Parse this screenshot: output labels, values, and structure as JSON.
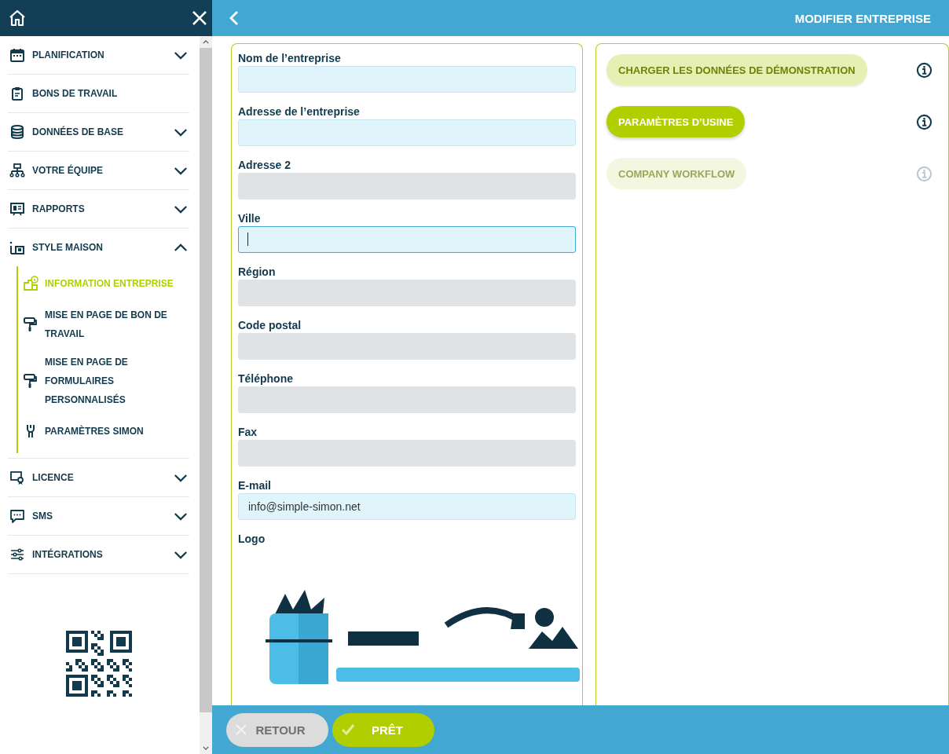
{
  "sidebar": {
    "items": [
      {
        "label": "PLANIFICATION",
        "kind": "group",
        "expanded": false
      },
      {
        "label": "BONS DE TRAVAIL",
        "kind": "link"
      },
      {
        "label": "DONNÉES DE BASE",
        "kind": "group",
        "expanded": false
      },
      {
        "label": "VOTRE ÉQUIPE",
        "kind": "group",
        "expanded": false
      },
      {
        "label": "RAPPORTS",
        "kind": "group",
        "expanded": false
      },
      {
        "label": "STYLE MAISON",
        "kind": "group",
        "expanded": true,
        "children": [
          {
            "label": "INFORMATION ENTREPRISE",
            "selected": true
          },
          {
            "label": "MISE EN PAGE DE BON DE TRAVAIL",
            "selected": false
          },
          {
            "label": "MISE EN PAGE DE FORMULAIRES PERSONNALISÉS",
            "selected": false
          },
          {
            "label": "PARAMÈTRES SIMON",
            "selected": false
          }
        ]
      },
      {
        "label": "LICENCE",
        "kind": "group",
        "expanded": false
      },
      {
        "label": "SMS",
        "kind": "group",
        "expanded": false
      },
      {
        "label": "INTÉGRATIONS",
        "kind": "group",
        "expanded": false
      }
    ]
  },
  "header": {
    "title": "MODIFIER ENTREPRISE"
  },
  "form": {
    "fields": [
      {
        "label": "Nom de l’entreprise",
        "disabled": false,
        "focused": false
      },
      {
        "label": "Adresse de l’entreprise",
        "disabled": false,
        "focused": false
      },
      {
        "label": "Adresse 2",
        "disabled": true,
        "focused": false
      },
      {
        "label": "Ville",
        "disabled": false,
        "focused": true
      },
      {
        "label": "Région",
        "disabled": true,
        "focused": false
      },
      {
        "label": "Code postal",
        "disabled": true,
        "focused": false
      },
      {
        "label": "Téléphone",
        "disabled": true,
        "focused": false
      },
      {
        "label": "Fax",
        "disabled": true,
        "focused": false
      },
      {
        "label": "E-mail",
        "value": "info@simple-simon.net",
        "disabled": false,
        "focused": false
      }
    ],
    "logo": {
      "label": "Logo",
      "kind": "picture"
    }
  },
  "actions": [
    {
      "label": "CHARGER LES DONNÉES DE DÉMONSTRATION",
      "faded": true,
      "disabled": false
    },
    {
      "label": "PARAMÈTRES D’USINE",
      "faded": false,
      "disabled": false
    },
    {
      "label": "COMPANY WORKFLOW",
      "faded": false,
      "disabled": true
    }
  ],
  "footer": {
    "buttons": [
      {
        "label": "RETOUR",
        "kind": "cancel"
      },
      {
        "label": "PRÊT",
        "kind": "confirm"
      }
    ]
  }
}
